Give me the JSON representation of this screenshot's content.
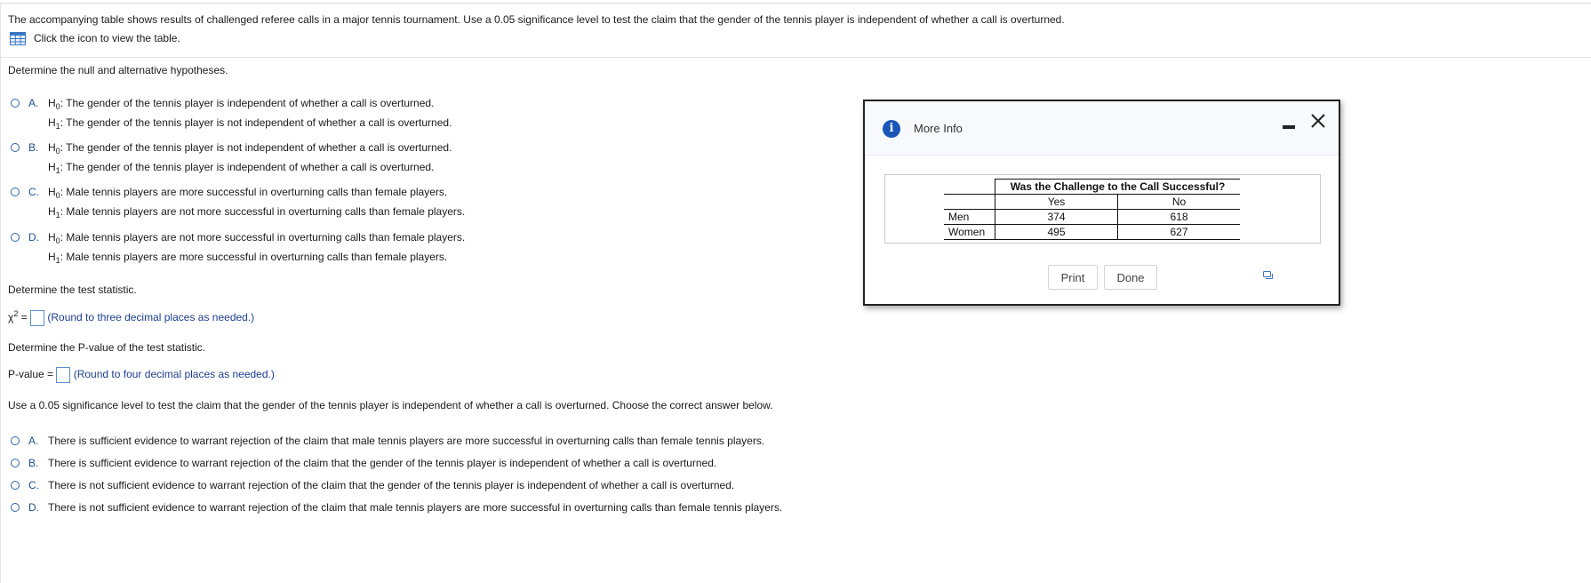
{
  "question": {
    "intro": "The accompanying table shows results of challenged referee calls in a major tennis tournament. Use a 0.05 significance level to test the claim that the gender of the tennis player is independent of whether a call is overturned.",
    "table_link": "Click the icon to view the table."
  },
  "hypotheses": {
    "prompt": "Determine the null and alternative hypotheses.",
    "h0_prefix": "H",
    "h0_sub": "0",
    "h1_prefix": "H",
    "h1_sub": "1",
    "options": [
      {
        "letter": "A.",
        "h0": ": The gender of the tennis player is independent of whether a call is overturned.",
        "h1": ": The gender of the tennis player is not independent of whether a call is overturned."
      },
      {
        "letter": "B.",
        "h0": ": The gender of the tennis player is not independent of whether a call is overturned.",
        "h1": ": The gender of the tennis player is independent of whether a call is overturned."
      },
      {
        "letter": "C.",
        "h0": ": Male tennis players are more successful in overturning calls than female players.",
        "h1": ": Male tennis players are not more successful in overturning calls than female players."
      },
      {
        "letter": "D.",
        "h0": ": Male tennis players are not more successful in overturning calls than female players.",
        "h1": ": Male tennis players are more successful in overturning calls than female players."
      }
    ]
  },
  "test_stat": {
    "prompt": "Determine the test statistic.",
    "symbol": "χ",
    "sup": "2",
    "equals": " =",
    "hint": "(Round to three decimal places as needed.)"
  },
  "pvalue": {
    "prompt": "Determine the P-value of the test statistic.",
    "label": "P-value =",
    "hint": "(Round to four decimal places as needed.)"
  },
  "conclusion": {
    "prompt": "Use a 0.05 significance level to test the claim that the gender of the tennis player is independent of whether a call is overturned. Choose the correct answer below.",
    "options": [
      {
        "letter": "A.",
        "text": "There is sufficient evidence to warrant rejection of the claim that male tennis players are more successful in overturning calls than female tennis players."
      },
      {
        "letter": "B.",
        "text": "There is sufficient evidence to warrant rejection of the claim that the gender of the tennis player is independent of whether a call is overturned."
      },
      {
        "letter": "C.",
        "text": "There is not sufficient evidence to warrant rejection of the claim that the gender of the tennis player is independent of whether a call is overturned."
      },
      {
        "letter": "D.",
        "text": "There is not sufficient evidence to warrant rejection of the claim that male tennis players are more successful in overturning calls than female tennis players."
      }
    ]
  },
  "modal": {
    "title": "More Info",
    "info_glyph": "i",
    "table": {
      "header": "Was the Challenge to the Call Successful?",
      "columns": [
        "Yes",
        "No"
      ],
      "rows": [
        {
          "label": "Men",
          "values": [
            "374",
            "618"
          ]
        },
        {
          "label": "Women",
          "values": [
            "495",
            "627"
          ]
        }
      ]
    },
    "print_label": "Print",
    "done_label": "Done"
  },
  "colors": {
    "radio": "#2a63a8",
    "hint_text": "#1d3d8f",
    "info_icon": "#1a56b8"
  }
}
